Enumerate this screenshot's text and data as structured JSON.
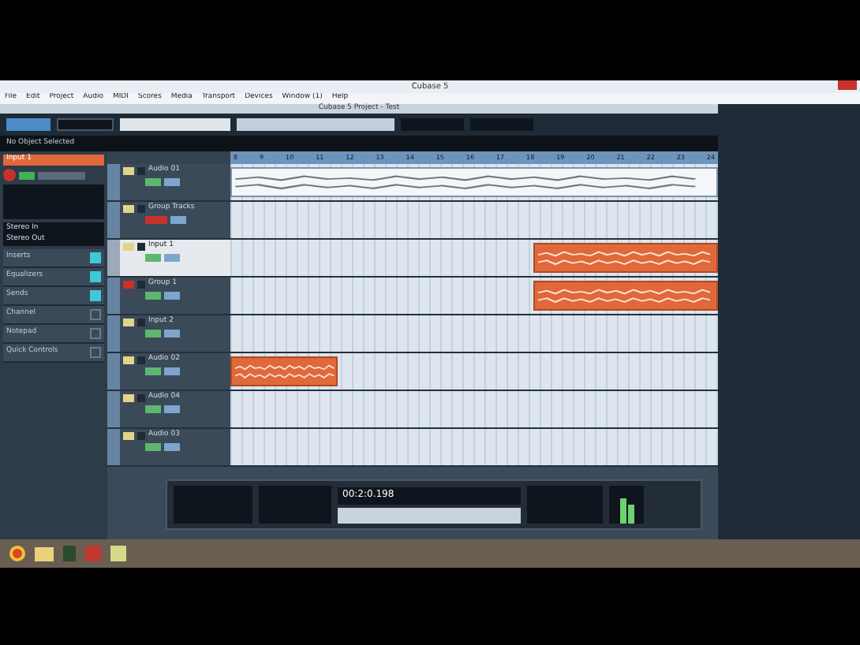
{
  "window": {
    "title": "Cubase 5"
  },
  "menu": [
    "File",
    "Edit",
    "Project",
    "Audio",
    "MIDI",
    "Scores",
    "Media",
    "Transport",
    "Devices",
    "Window (1)",
    "Help"
  ],
  "project_window": {
    "title": "Cubase 5 Project - Test"
  },
  "info_line": "No Object Selected",
  "inspector": {
    "track_name": "Input 1",
    "routing": [
      "Stereo In",
      "Stereo Out"
    ],
    "sections": [
      {
        "label": "Inserts",
        "on": true
      },
      {
        "label": "Equalizers",
        "on": true
      },
      {
        "label": "Sends",
        "on": true
      },
      {
        "label": "Channel",
        "on": false
      },
      {
        "label": "Notepad",
        "on": false
      },
      {
        "label": "Quick Controls",
        "on": false
      }
    ]
  },
  "ruler": [
    "8",
    "9",
    "10",
    "11",
    "12",
    "13",
    "14",
    "15",
    "16",
    "17",
    "18",
    "19",
    "20",
    "21",
    "22",
    "23",
    "24"
  ],
  "tracks": [
    {
      "name": "Audio 01",
      "kind": "audio",
      "selected": false,
      "parts": [
        {
          "kind": "white-full"
        }
      ]
    },
    {
      "name": "Group Tracks",
      "kind": "folder",
      "selected": false
    },
    {
      "name": "Input 1",
      "kind": "audio",
      "selected": true,
      "parts": [
        {
          "kind": "orange-end"
        }
      ]
    },
    {
      "name": "Group 1",
      "kind": "group",
      "selected": false,
      "parts": [
        {
          "kind": "orange-end"
        }
      ]
    },
    {
      "name": "Input 2",
      "kind": "audio",
      "selected": false
    },
    {
      "name": "Audio 02",
      "kind": "audio",
      "selected": false,
      "parts": [
        {
          "kind": "orange-start"
        }
      ]
    },
    {
      "name": "Audio 04",
      "kind": "audio",
      "selected": false
    },
    {
      "name": "Audio 03",
      "kind": "audio",
      "selected": false
    }
  ],
  "transport": {
    "position": "00:2:0.198"
  }
}
